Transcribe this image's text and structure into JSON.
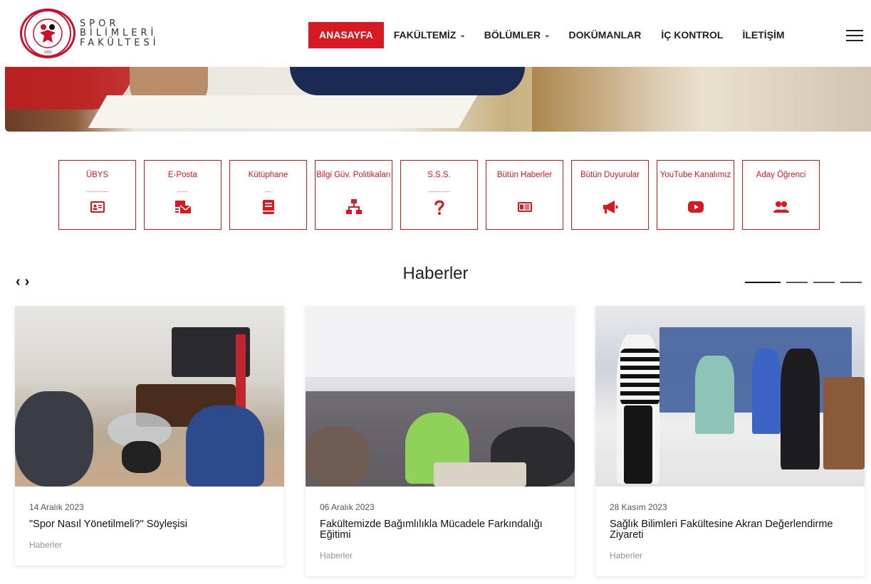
{
  "header": {
    "logo_lines": [
      "SPOR",
      "BİLİMLERİ",
      "FAKÜLTESİ"
    ],
    "logo_emblem_text": "KASTAMONU ÜNİVERSİTESİ SPOR BİLİMLERİ FAKÜLTESİ 1955",
    "nav": [
      {
        "label": "ANASAYFA",
        "active": true,
        "dropdown": false
      },
      {
        "label": "FAKÜLTEMİZ",
        "active": false,
        "dropdown": true
      },
      {
        "label": "BÖLÜMLER",
        "active": false,
        "dropdown": true
      },
      {
        "label": "DOKÜMANLAR",
        "active": false,
        "dropdown": false
      },
      {
        "label": "İÇ KONTROL",
        "active": false,
        "dropdown": false
      },
      {
        "label": "İLETİŞİM",
        "active": false,
        "dropdown": false
      }
    ],
    "menu_icon": "hamburger-icon"
  },
  "quick_links": [
    {
      "label": "ÜBYS",
      "dots": "..............",
      "icon": "id-card-icon"
    },
    {
      "label": "E-Posta",
      "dots": ".......",
      "icon": "mail-envelope-icon"
    },
    {
      "label": "Kütüphane",
      "dots": "....",
      "icon": "book-icon"
    },
    {
      "label": "Bilgi Güv. Politikaları",
      "dots": "",
      "icon": "network-sitemap-icon"
    },
    {
      "label": "S.S.S.",
      "dots": "..............",
      "icon": "question-icon"
    },
    {
      "label": "Bütün Haberler",
      "dots": "",
      "icon": "newspaper-icon"
    },
    {
      "label": "Bütün Duyurular",
      "dots": "",
      "icon": "megaphone-icon"
    },
    {
      "label": "YouTube Kanalımız",
      "dots": "",
      "icon": "youtube-icon"
    },
    {
      "label": "Aday Öğrenci",
      "dots": "",
      "icon": "users-icon"
    }
  ],
  "news": {
    "title": "Haberler",
    "prev_label": "‹",
    "next_label": "›",
    "pagination": [
      true,
      false,
      false,
      false
    ],
    "items": [
      {
        "date": "14 Aralık 2023",
        "title": "\"Spor Nasıl Yönetilmeli?\" Söyleşisi",
        "category": "Haberler"
      },
      {
        "date": "06 Aralık 2023",
        "title": "Fakültemizde Bağımlılıkla Mücadele Farkındalığı Eğitimi",
        "category": "Haberler"
      },
      {
        "date": "28 Kasım 2023",
        "title": "Sağlık Bilimleri Fakültesine Akran Değerlendirme Ziyareti",
        "category": "Haberler"
      }
    ]
  },
  "colors": {
    "accent": "#d71a21",
    "text": "#222222",
    "muted": "#8a9599"
  }
}
